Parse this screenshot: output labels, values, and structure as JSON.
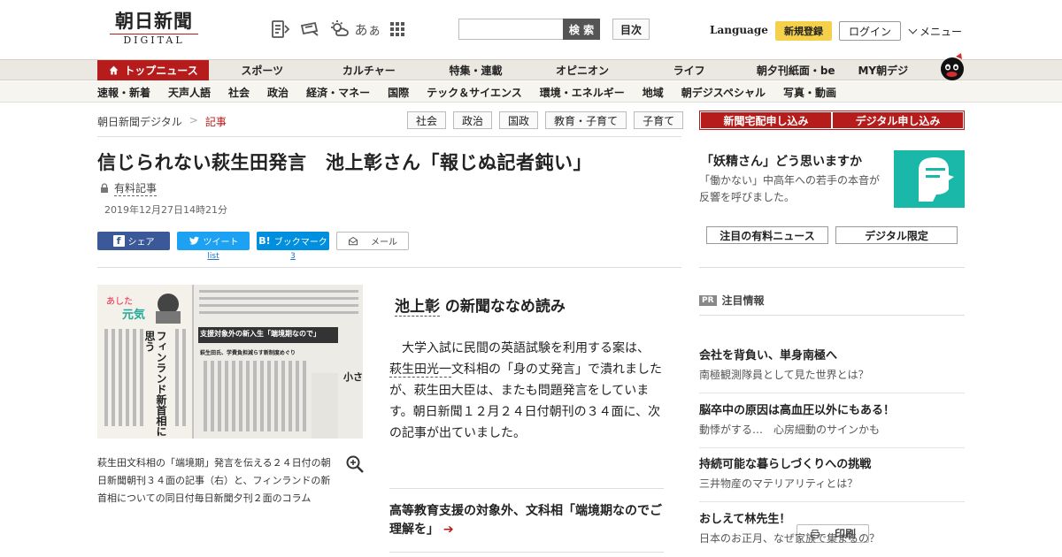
{
  "header": {
    "logo_kanji": "朝日新聞",
    "logo_sub": "DIGITAL",
    "search_placeholder": "",
    "search_button": "検 索",
    "index_button": "目次",
    "language": "Language",
    "signup": "新規登録",
    "login": "ログイン",
    "menu": "メニュー",
    "font_size_icon": "あぁ",
    "icons": [
      "news-brief-icon",
      "newspaper-icon",
      "weather-icon",
      "font-size-icon",
      "apps-grid-icon"
    ]
  },
  "nav_main": [
    "トップニュース",
    "スポーツ",
    "カルチャー",
    "特集・連載",
    "オピニオン",
    "ライフ",
    "朝夕刊紙面・be",
    "MY朝デジ"
  ],
  "nav_sub": [
    "速報・新着",
    "天声人語",
    "社会",
    "政治",
    "経済・マネー",
    "国際",
    "テック＆サイエンス",
    "環境・エネルギー",
    "地域",
    "朝デジスペシャル",
    "写真・動画"
  ],
  "breadcrumb": {
    "home": "朝日新聞デジタル",
    "sep": ">",
    "current": "記事"
  },
  "tags": [
    "社会",
    "政治",
    "国政",
    "教育・子育て",
    "子育て"
  ],
  "article": {
    "headline": "信じられない萩生田発言　池上彰さん「報じぬ記者鈍い」",
    "paid_label": "有料記事",
    "date": "2019年12月27日14時21分",
    "share": {
      "facebook": "シェア",
      "twitter": "ツイート",
      "twitter_sub": "list",
      "hatena": "ブックマーク",
      "hatena_count": "3",
      "mail": "メール",
      "print": "印刷"
    },
    "caption": "萩生田文科相の「端境期」発言を伝える２４日付の朝日新聞朝刊３４面の記事（右）と、フィンランドの新首相についての同日付毎日新聞夕刊２面のコラム",
    "image_texts": {
      "headline_box": "支援対象外の新入生「端境期なので」",
      "sub": "萩生田氏、学費負担減らす新制度めぐり",
      "vertical": "フィンランド新首相に思う",
      "corner": "小さ"
    },
    "series_name": "池上彰",
    "series_rest": " の新聞ななめ読み",
    "body_1": "大学入試に民間の英語試験を利用する案は、",
    "body_link": "萩生田光一",
    "body_2": "文科相の「身の丈発言」で潰れましたが、萩生田大臣は、またも問題発言をしています。朝日新聞１２月２４日付朝刊の３４面に、次の記事が出ていました。",
    "related": "高等教育支援の対象外、文科相「端境期なのでご理解を」",
    "related_arrow": "➔"
  },
  "sidebar": {
    "subscribe_paper": "新聞宅配申し込み",
    "subscribe_digital": "デジタル申し込み",
    "promo_title": "「妖精さん」どう思いますか",
    "promo_text": "「働かない」中高年への若手の本音が反響を呼びました。",
    "tab_paid": "注目の有料ニュース",
    "tab_digital": "デジタル限定",
    "pr_badge": "PR",
    "pr_heading": "注目情報",
    "pr_items": [
      {
        "title": "会社を背負い、単身南極へ",
        "sub": "南極観測隊員として見た世界とは？"
      },
      {
        "title": "脳卒中の原因は高血圧以外にもある！",
        "sub": "動悸がする…　心房細動のサインかも"
      },
      {
        "title": "持続可能な暮らしづくりへの挑戦",
        "sub": "三井物産のマテリアリティとは？"
      },
      {
        "title": "おしえて林先生！",
        "sub": "日本のお正月、なぜ家族で集まるの？"
      }
    ]
  },
  "colors": {
    "brand_red": "#b71c1c",
    "signup_yellow": "#f5d04a",
    "facebook": "#3b5998",
    "twitter": "#1da1f2",
    "hatena": "#008fde",
    "promo_teal": "#19b8a8"
  }
}
